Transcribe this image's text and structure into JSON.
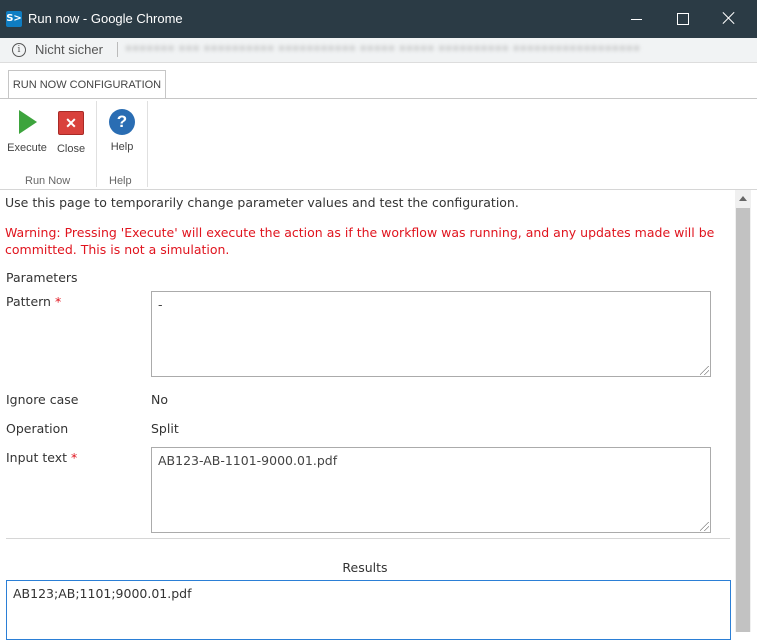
{
  "window": {
    "title": "Run now - Google Chrome",
    "app_icon": "sharepoint-icon"
  },
  "address_bar": {
    "security_label": "Nicht sicher",
    "url_blurred": "••••••• ••• •••••••••• ••••••••••• ••••• ••••• •••••••••• ••••••••••••••••••"
  },
  "ribbon": {
    "tab_label": "RUN NOW CONFIGURATION",
    "buttons": {
      "execute": "Execute",
      "close": "Close",
      "help": "Help"
    },
    "groups": {
      "run_now": "Run Now",
      "help": "Help"
    }
  },
  "content": {
    "intro": "Use this page to temporarily change parameter values and test the configuration.",
    "warning": "Warning: Pressing 'Execute' will execute the action as if the workflow was running, and any updates made will be committed. This is not a simulation.",
    "parameters_title": "Parameters",
    "fields": {
      "pattern": {
        "label": "Pattern",
        "required": "*",
        "value": "-"
      },
      "ignore_case": {
        "label": "Ignore case",
        "value": "No"
      },
      "operation": {
        "label": "Operation",
        "value": "Split"
      },
      "input_text": {
        "label": "Input text",
        "required": "*",
        "value": "AB123-AB-1101-9000.01.pdf"
      }
    },
    "results_title": "Results",
    "results_value": "AB123;AB;1101;9000.01.pdf"
  },
  "colors": {
    "titlebar": "#2b3b45",
    "warning": "#e0141e",
    "execute_green": "#3da43d",
    "close_red": "#d9413c",
    "help_blue": "#2a6db3",
    "focus_blue": "#2b7fd6"
  }
}
